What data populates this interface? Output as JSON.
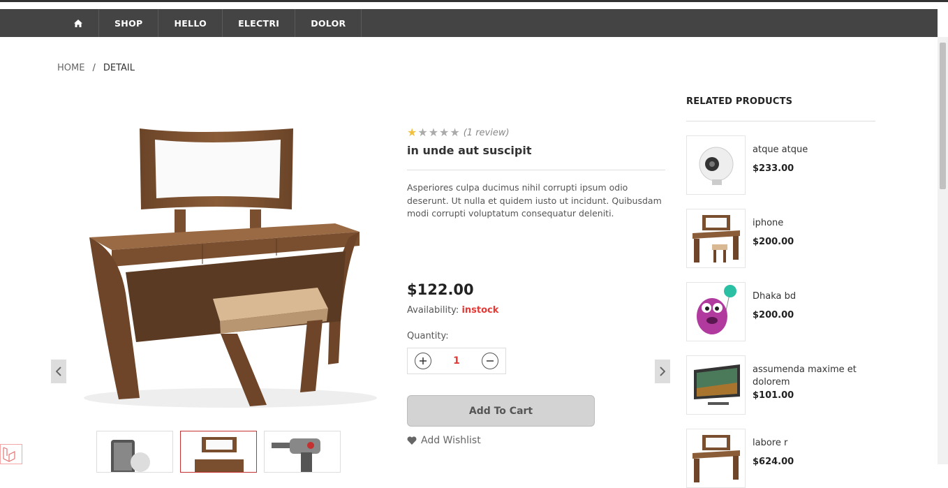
{
  "nav": {
    "items": [
      "SHOP",
      "HELLO",
      "ELECTRI",
      "DOLOR"
    ]
  },
  "breadcrumb": {
    "home": "HOME",
    "separator": "/",
    "current": "DETAIL"
  },
  "product": {
    "rating": 1,
    "rating_max": 5,
    "review_text": "(1 review)",
    "title": "in unde aut suscipit",
    "description": "Asperiores culpa ducimus nihil corrupti ipsum odio deserunt. Ut nulla et quidem iusto ut incidunt. Quibusdam modi corrupti voluptatum consequatur deleniti.",
    "price": "$122.00",
    "availability_label": "Availability:",
    "availability_value": "instock",
    "quantity_label": "Quantity:",
    "quantity_value": "1",
    "add_to_cart_label": "Add To Cart",
    "wishlist_label": "Add Wishlist"
  },
  "related": {
    "title": "RELATED PRODUCTS",
    "items": [
      {
        "name": "atque atque",
        "price": "$233.00",
        "icon": "camera-360-image"
      },
      {
        "name": "iphone",
        "price": "$200.00",
        "icon": "dressing-table-image"
      },
      {
        "name": "Dhaka bd",
        "price": "$200.00",
        "icon": "plush-toy-image"
      },
      {
        "name": "assumenda maxime et dolorem",
        "price": "$101.00",
        "icon": "tv-image"
      },
      {
        "name": "labore r",
        "price": "$624.00",
        "icon": "dressing-table-image"
      }
    ]
  },
  "colors": {
    "accent": "#e53935",
    "nav_bg": "#444444",
    "star_on": "#f0c040"
  }
}
